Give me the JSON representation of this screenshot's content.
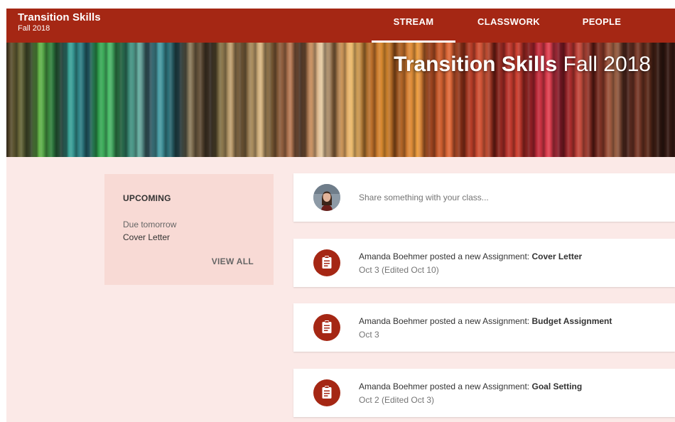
{
  "header": {
    "class_name": "Transition Skills",
    "section": "Fall 2018",
    "tabs": [
      {
        "label": "STREAM",
        "active": true
      },
      {
        "label": "CLASSWORK",
        "active": false
      },
      {
        "label": "PEOPLE",
        "active": false
      }
    ]
  },
  "banner": {
    "title_bold": "Transition Skills",
    "title_regular": "Fall 2018"
  },
  "upcoming": {
    "heading": "UPCOMING",
    "due_label": "Due tomorrow",
    "item": "Cover Letter",
    "view_all": "VIEW ALL"
  },
  "share": {
    "placeholder": "Share something with your class..."
  },
  "posts": [
    {
      "prefix": "Amanda Boehmer posted a new Assignment: ",
      "title": "Cover Letter",
      "date": "Oct 3 (Edited Oct 10)",
      "icon": "assignment-icon"
    },
    {
      "prefix": "Amanda Boehmer posted a new Assignment: ",
      "title": "Budget Assignment",
      "date": "Oct 3",
      "icon": "assignment-icon"
    },
    {
      "prefix": "Amanda Boehmer posted a new Assignment: ",
      "title": "Goal Setting",
      "date": "Oct 2 (Edited Oct 3)",
      "icon": "assignment-icon"
    }
  ],
  "colors": {
    "primary": "#a52714",
    "background": "#fbe9e7",
    "upcoming_card": "#f8dad5"
  }
}
